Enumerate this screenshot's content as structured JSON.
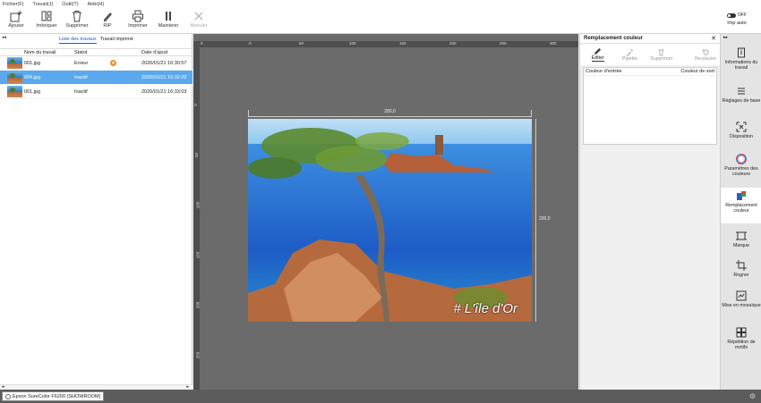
{
  "menu": [
    "Fichier(F)",
    "Travail(J)",
    "Outil(T)",
    "Aide(H)"
  ],
  "toolbar": {
    "buttons": [
      {
        "label": "Ajouter",
        "icon": "add-icon"
      },
      {
        "label": "Imbriquer",
        "icon": "nest-icon"
      },
      {
        "label": "Supprimer",
        "icon": "trash-icon"
      },
      {
        "label": "RIP",
        "icon": "rip-icon"
      },
      {
        "label": "Imprimer",
        "icon": "printer-icon"
      },
      {
        "label": "Maintenir",
        "icon": "pause-icon"
      },
      {
        "label": "Annuler",
        "icon": "cancel-icon",
        "disabled": true
      }
    ],
    "impauto": {
      "label": "Imp auto",
      "state": "OFF"
    }
  },
  "jobs": {
    "tabs": [
      "Liste des travaux",
      "Travail imprimé"
    ],
    "columns": [
      "Nom du travail",
      "Statut",
      "Date d'ajout"
    ],
    "rows": [
      {
        "name": "001.jpg",
        "status": "Erreur",
        "date": "2020/01/21 16:30:57",
        "error": true
      },
      {
        "name": "004.jpg",
        "status": "Inactif",
        "date": "2020/01/21 16:32:20",
        "selected": true
      },
      {
        "name": "001.jpg",
        "status": "Inactif",
        "date": "2020/01/21 16:33:03"
      }
    ]
  },
  "canvas": {
    "width_label": "280,0",
    "height_label": "200,0",
    "caption": "# L'île d'Or",
    "ruler_top": [
      "0",
      "0",
      "50",
      "100",
      "150",
      "200",
      "250",
      "300"
    ],
    "ruler_left": [
      "0",
      "50",
      "100",
      "150",
      "200",
      "250",
      "300"
    ]
  },
  "color_replace": {
    "title": "Remplacement couleur",
    "tools": [
      {
        "label": "Éditer",
        "icon": "pencil-icon",
        "active": true
      },
      {
        "label": "Pipette",
        "icon": "eyedropper-icon"
      },
      {
        "label": "Supprimer",
        "icon": "trash-icon"
      },
      {
        "label": "Restaurer",
        "icon": "restore-icon"
      }
    ],
    "col_in": "Couleur d'entrée",
    "col_out": "Couleur de sort"
  },
  "rightnav": [
    {
      "label": "Informations du travail",
      "icon": "info-icon"
    },
    {
      "label": "Réglages de base",
      "icon": "list-icon"
    },
    {
      "label": "Disposition",
      "icon": "layout-icon"
    },
    {
      "label": "Paramètres des couleurs",
      "icon": "color-wheel-icon"
    },
    {
      "label": "Remplacement couleur",
      "icon": "color-replace-icon",
      "active": true
    },
    {
      "label": "Marque",
      "icon": "mark-icon"
    },
    {
      "label": "Rogner",
      "icon": "crop-icon"
    },
    {
      "label": "Mise en mosaïque",
      "icon": "tile-icon"
    },
    {
      "label": "Répétition de motifs",
      "icon": "pattern-icon"
    }
  ],
  "status": {
    "printer": "Epson SureColor F6200 (SHOWROOM)"
  },
  "colors": {
    "accent": "#5aa9ef",
    "canvas": "#6b6b6b",
    "error": "#f08a24"
  }
}
